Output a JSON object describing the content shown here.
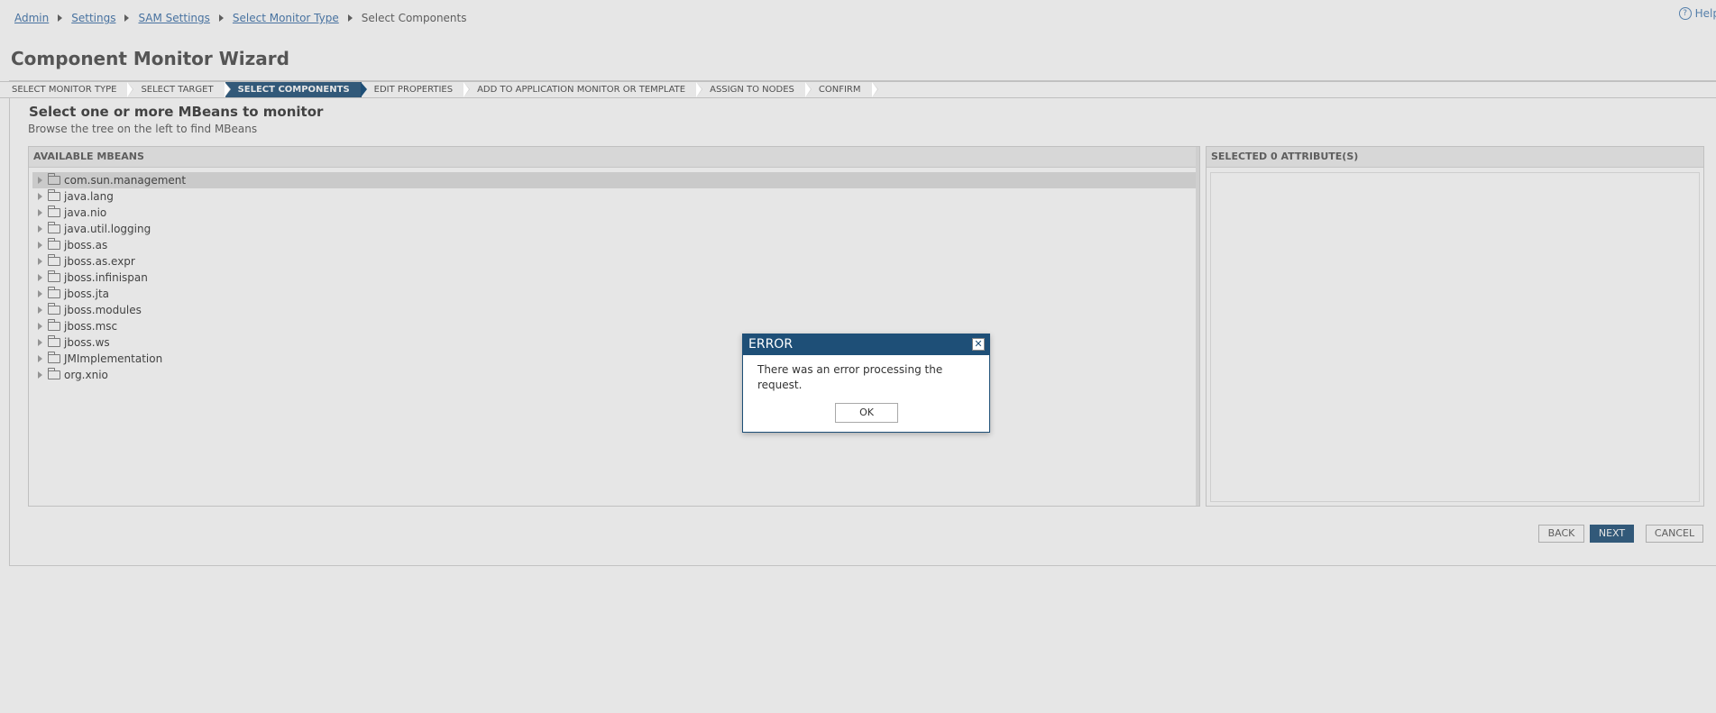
{
  "breadcrumb": {
    "items": [
      {
        "label": "Admin"
      },
      {
        "label": "Settings"
      },
      {
        "label": "SAM Settings"
      },
      {
        "label": "Select Monitor Type"
      }
    ],
    "current": "Select Components"
  },
  "help": {
    "label": "Help"
  },
  "page": {
    "title": "Component Monitor Wizard"
  },
  "steps": [
    {
      "label": "SELECT MONITOR TYPE"
    },
    {
      "label": "SELECT TARGET"
    },
    {
      "label": "SELECT COMPONENTS",
      "active": true
    },
    {
      "label": "EDIT PROPERTIES"
    },
    {
      "label": "ADD TO APPLICATION MONITOR OR TEMPLATE"
    },
    {
      "label": "ASSIGN TO NODES"
    },
    {
      "label": "CONFIRM"
    }
  ],
  "section": {
    "title": "Select one or more MBeans to monitor",
    "subtitle": "Browse the tree on the left to find MBeans"
  },
  "available_panel": {
    "header": "AVAILABLE MBEANS",
    "items": [
      {
        "label": "com.sun.management"
      },
      {
        "label": "java.lang"
      },
      {
        "label": "java.nio"
      },
      {
        "label": "java.util.logging"
      },
      {
        "label": "jboss.as"
      },
      {
        "label": "jboss.as.expr"
      },
      {
        "label": "jboss.infinispan"
      },
      {
        "label": "jboss.jta"
      },
      {
        "label": "jboss.modules"
      },
      {
        "label": "jboss.msc"
      },
      {
        "label": "jboss.ws"
      },
      {
        "label": "JMImplementation"
      },
      {
        "label": "org.xnio"
      }
    ]
  },
  "selected_panel": {
    "header": "SELECTED 0 ATTRIBUTE(S)"
  },
  "buttons": {
    "back": "BACK",
    "next": "NEXT",
    "cancel": "CANCEL"
  },
  "dialog": {
    "title": "ERROR",
    "message": "There was an error processing the request.",
    "ok_label": "OK",
    "close_glyph": "✕"
  },
  "colors": {
    "accent": "#1e4f77",
    "link": "#3a6fa8"
  }
}
